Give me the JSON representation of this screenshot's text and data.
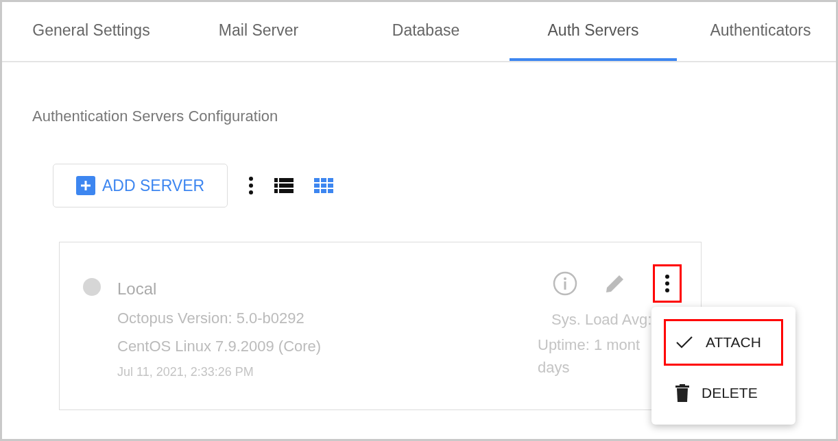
{
  "tabs": [
    {
      "label": "General Settings",
      "selected": false
    },
    {
      "label": "Mail Server",
      "selected": false
    },
    {
      "label": "Database",
      "selected": false
    },
    {
      "label": "Auth Servers",
      "selected": true
    },
    {
      "label": "Authenticators",
      "selected": false
    }
  ],
  "section_title": "Authentication Servers Configuration",
  "toolbar": {
    "add_button": "ADD SERVER",
    "view_modes": [
      {
        "kind": "list",
        "selected": false
      },
      {
        "kind": "grid",
        "selected": true
      }
    ]
  },
  "server": {
    "name": "Local",
    "color": "#d6d6d6",
    "details": [
      "Octopus Version: 5.0-b0292",
      "CentOS Linux 7.9.2009 (Core)"
    ],
    "timestamp": "Jul 11, 2021, 2:33:26 PM",
    "stats": [
      "Sys. Load Avg:",
      "Uptime: 1 mont",
      "days"
    ],
    "more_highlighted": true
  },
  "menu": {
    "items": [
      {
        "kind": "attach",
        "label": "ATTACH",
        "highlighted": true
      },
      {
        "kind": "delete",
        "label": "DELETE",
        "highlighted": false
      }
    ]
  }
}
